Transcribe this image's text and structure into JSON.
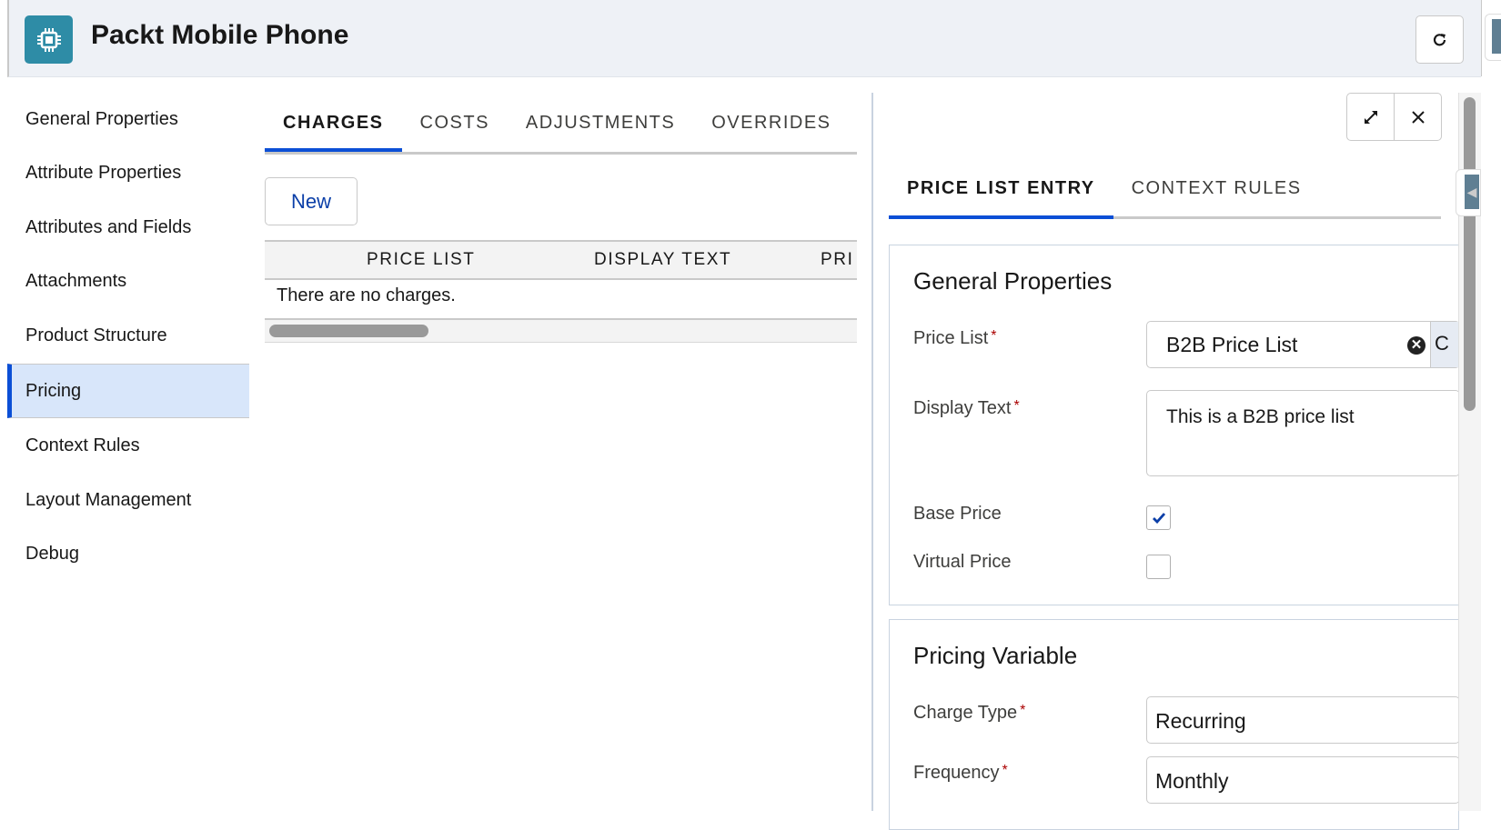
{
  "header": {
    "title": "Packt Mobile Phone",
    "app_icon": "chip-icon",
    "refresh_icon": "refresh-icon"
  },
  "sidebar": {
    "items": [
      {
        "label": "General Properties",
        "active": false
      },
      {
        "label": "Attribute Properties",
        "active": false
      },
      {
        "label": "Attributes and Fields",
        "active": false
      },
      {
        "label": "Attachments",
        "active": false
      },
      {
        "label": "Product Structure",
        "active": false
      },
      {
        "label": "Pricing",
        "active": true
      },
      {
        "label": "Context Rules",
        "active": false
      },
      {
        "label": "Layout Management",
        "active": false
      },
      {
        "label": "Debug",
        "active": false
      }
    ]
  },
  "main": {
    "tabs": [
      {
        "label": "CHARGES",
        "active": true
      },
      {
        "label": "COSTS",
        "active": false
      },
      {
        "label": "ADJUSTMENTS",
        "active": false
      },
      {
        "label": "OVERRIDES",
        "active": false
      }
    ],
    "new_button": "New",
    "table": {
      "columns": [
        "PRICE LIST",
        "DISPLAY TEXT",
        "PRI"
      ],
      "empty_message": "There are no charges."
    }
  },
  "panel": {
    "expand_icon": "expand-icon",
    "close_icon": "close-icon",
    "tabs": [
      {
        "label": "PRICE LIST ENTRY",
        "active": true
      },
      {
        "label": "CONTEXT RULES",
        "active": false
      }
    ],
    "general": {
      "title": "General Properties",
      "price_list_label": "Price List",
      "price_list_value": "B2B Price List",
      "display_text_label": "Display Text",
      "display_text_value": "This is a B2B price list",
      "base_price_label": "Base Price",
      "base_price_checked": true,
      "virtual_price_label": "Virtual Price",
      "virtual_price_checked": false
    },
    "pricing_variable": {
      "title": "Pricing Variable",
      "charge_type_label": "Charge Type",
      "charge_type_value": "Recurring",
      "frequency_label": "Frequency",
      "frequency_value": "Monthly"
    },
    "required_marker": "*"
  },
  "colors": {
    "accent": "#0b4fd6",
    "app_icon_bg": "#2e8ca6",
    "active_nav_bg": "#d8e6fa",
    "header_bg": "#eef1f6"
  }
}
